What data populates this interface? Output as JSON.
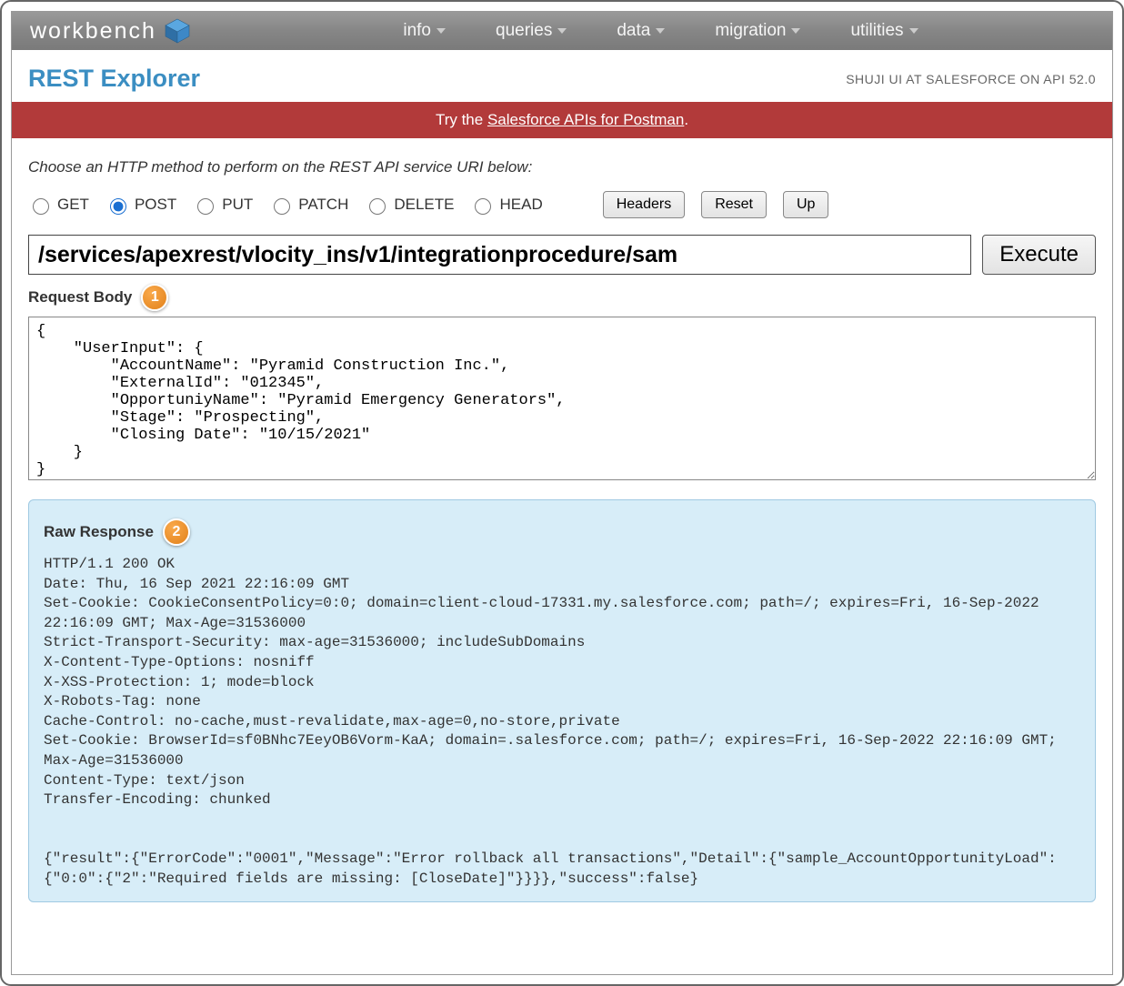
{
  "brand": "workbench",
  "nav": [
    "info",
    "queries",
    "data",
    "migration",
    "utilities"
  ],
  "page_title": "REST Explorer",
  "session_info": "SHUJI UI AT SALESFORCE ON API 52.0",
  "banner_prefix": "Try the ",
  "banner_link": "Salesforce APIs for Postman",
  "banner_suffix": ".",
  "instruction": "Choose an HTTP method to perform on the REST API service URI below:",
  "methods": {
    "get": "GET",
    "post": "POST",
    "put": "PUT",
    "patch": "PATCH",
    "delete": "DELETE",
    "head": "HEAD",
    "selected": "POST"
  },
  "buttons": {
    "headers": "Headers",
    "reset": "Reset",
    "up": "Up",
    "execute": "Execute"
  },
  "uri": "/services/apexrest/vlocity_ins/v1/integrationprocedure/sam",
  "request_body_label": "Request Body",
  "callout1": "1",
  "request_body": "{\n    \"UserInput\": {\n        \"AccountName\": \"Pyramid Construction Inc.\",\n        \"ExternalId\": \"012345\",\n        \"OpportuniyName\": \"Pyramid Emergency Generators\",\n        \"Stage\": \"Prospecting\",\n        \"Closing Date\": \"10/15/2021\"\n    }\n}",
  "raw_response_label": "Raw Response",
  "callout2": "2",
  "raw_response": "HTTP/1.1 200 OK\nDate: Thu, 16 Sep 2021 22:16:09 GMT\nSet-Cookie: CookieConsentPolicy=0:0; domain=client-cloud-17331.my.salesforce.com; path=/; expires=Fri, 16-Sep-2022 22:16:09 GMT; Max-Age=31536000\nStrict-Transport-Security: max-age=31536000; includeSubDomains\nX-Content-Type-Options: nosniff\nX-XSS-Protection: 1; mode=block\nX-Robots-Tag: none\nCache-Control: no-cache,must-revalidate,max-age=0,no-store,private\nSet-Cookie: BrowserId=sf0BNhc7EeyOB6Vorm-KaA; domain=.salesforce.com; path=/; expires=Fri, 16-Sep-2022 22:16:09 GMT; Max-Age=31536000\nContent-Type: text/json\nTransfer-Encoding: chunked\n\n\n{\"result\":{\"ErrorCode\":\"0001\",\"Message\":\"Error rollback all transactions\",\"Detail\":{\"sample_AccountOpportunityLoad\":{\"0:0\":{\"2\":\"Required fields are missing: [CloseDate]\"}}}},\"success\":false}"
}
